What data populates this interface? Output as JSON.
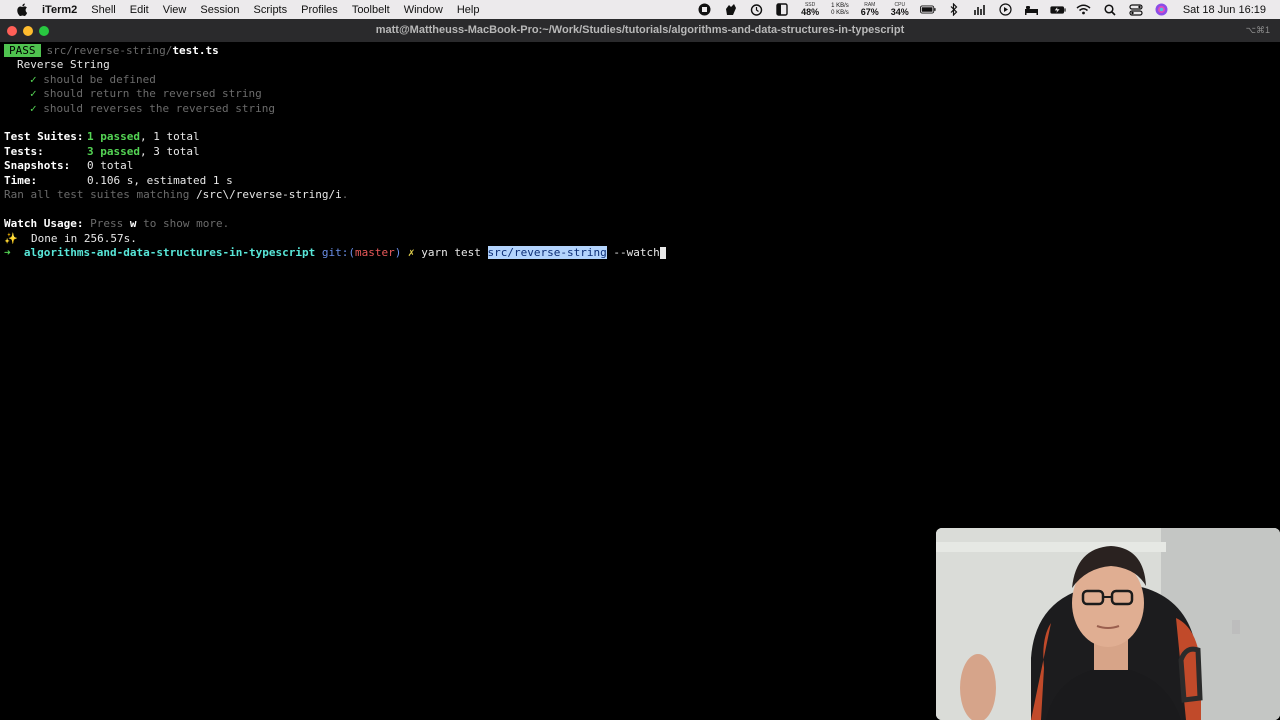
{
  "menubar": {
    "app_name": "iTerm2",
    "items": [
      "Shell",
      "Edit",
      "View",
      "Session",
      "Scripts",
      "Profiles",
      "Toolbelt",
      "Window",
      "Help"
    ],
    "status": {
      "ssd_label": "SSD",
      "ssd_value": "48%",
      "net_up": "1 KB/s",
      "net_down": "0 KB/s",
      "ram_label": "RAM",
      "ram_value": "67%",
      "cpu_label": "CPU",
      "cpu_value": "34%"
    },
    "clock": "Sat 18 Jun  16:19"
  },
  "window": {
    "title": "matt@Mattheuss-MacBook-Pro:~/Work/Studies/tutorials/algorithms-and-data-structures-in-typescript",
    "shortcut": "⌥⌘1"
  },
  "terminal": {
    "pass_badge": "PASS",
    "test_path_dir": "src/reverse-string/",
    "test_path_file": "test.ts",
    "suite_name": "Reverse String",
    "tests": [
      "should be defined",
      "should return the reversed string",
      "should reverses the reversed string"
    ],
    "check": "✓",
    "summary": {
      "suites_label": "Test Suites:",
      "suites_passed": "1 passed",
      "suites_total": ", 1 total",
      "tests_label": "Tests:",
      "tests_passed": "3 passed",
      "tests_total": ", 3 total",
      "snapshots_label": "Snapshots:",
      "snapshots_value": "0 total",
      "time_label": "Time:",
      "time_value": "0.106 s, estimated 1 s",
      "ran_prefix": "Ran all test suites matching ",
      "ran_pattern": "/src\\/reverse-string/i",
      "ran_suffix": "."
    },
    "watch_label": "Watch Usage:",
    "watch_text_1": "Press ",
    "watch_key": "w",
    "watch_text_2": " to show more.",
    "done_sparkle": "✨",
    "done_text": "  Done in 256.57s.",
    "prompt": {
      "arrow": "➜",
      "dir": "algorithms-and-data-structures-in-typescript",
      "git_label": "git:(",
      "branch": "master",
      "git_close": ")",
      "dirty": "✗",
      "cmd": "yarn test ",
      "selected_arg": "src/reverse-string",
      "rest": " --watch"
    }
  },
  "colors": {
    "terminal_bg": "#000000",
    "pass_badge_bg": "#4fc34f",
    "green_text": "#54d454",
    "cyan_prompt": "#58e6d8",
    "selection_bg": "#b3d4fd"
  }
}
